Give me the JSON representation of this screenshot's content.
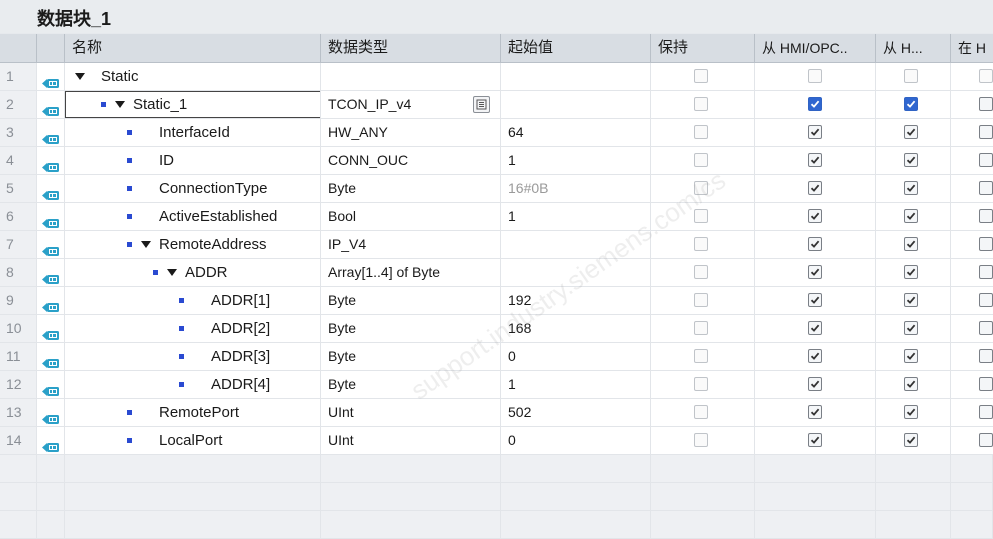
{
  "window": {
    "title": "数据块_1"
  },
  "columns": {
    "name": "名称",
    "data_type": "数据类型",
    "start_value": "起始值",
    "retain": "保持",
    "hmi_opc": "从 HMI/OPC..",
    "hmi_h": "从 H...",
    "in_h": "在 H"
  },
  "rows": [
    {
      "num": "1",
      "name": "Static",
      "type": "",
      "start": "",
      "level": 0,
      "expander": true,
      "bullet": false,
      "retain": false,
      "hmi1": false,
      "hmi2": false,
      "hmi_disabled": true
    },
    {
      "num": "2",
      "name": "Static_1",
      "type": "TCON_IP_v4",
      "start": "",
      "level": 1,
      "expander": true,
      "bullet": true,
      "retain": false,
      "hmi1": true,
      "hmi2": true,
      "selected": true
    },
    {
      "num": "3",
      "name": "InterfaceId",
      "type": "HW_ANY",
      "start": "64",
      "level": 2,
      "expander": false,
      "bullet": true,
      "retain": false,
      "hmi1": true,
      "hmi2": true
    },
    {
      "num": "4",
      "name": "ID",
      "type": "CONN_OUC",
      "start": "1",
      "level": 2,
      "expander": false,
      "bullet": true,
      "retain": false,
      "hmi1": true,
      "hmi2": true
    },
    {
      "num": "5",
      "name": "ConnectionType",
      "type": "Byte",
      "start": "16#0B",
      "level": 2,
      "expander": false,
      "bullet": true,
      "retain": false,
      "hmi1": true,
      "hmi2": true,
      "start_grey": true
    },
    {
      "num": "6",
      "name": "ActiveEstablished",
      "type": "Bool",
      "start": "1",
      "level": 2,
      "expander": false,
      "bullet": true,
      "retain": false,
      "hmi1": true,
      "hmi2": true
    },
    {
      "num": "7",
      "name": "RemoteAddress",
      "type": "IP_V4",
      "start": "",
      "level": 2,
      "expander": true,
      "bullet": true,
      "retain": false,
      "hmi1": true,
      "hmi2": true
    },
    {
      "num": "8",
      "name": "ADDR",
      "type": "Array[1..4] of Byte",
      "start": "",
      "level": 3,
      "expander": true,
      "bullet": true,
      "retain": false,
      "hmi1": true,
      "hmi2": true
    },
    {
      "num": "9",
      "name": "ADDR[1]",
      "type": "Byte",
      "start": "192",
      "level": 4,
      "expander": false,
      "bullet": true,
      "retain": false,
      "hmi1": true,
      "hmi2": true
    },
    {
      "num": "10",
      "name": "ADDR[2]",
      "type": "Byte",
      "start": "168",
      "level": 4,
      "expander": false,
      "bullet": true,
      "retain": false,
      "hmi1": true,
      "hmi2": true
    },
    {
      "num": "11",
      "name": "ADDR[3]",
      "type": "Byte",
      "start": "0",
      "level": 4,
      "expander": false,
      "bullet": true,
      "retain": false,
      "hmi1": true,
      "hmi2": true
    },
    {
      "num": "12",
      "name": "ADDR[4]",
      "type": "Byte",
      "start": "1",
      "level": 4,
      "expander": false,
      "bullet": true,
      "retain": false,
      "hmi1": true,
      "hmi2": true
    },
    {
      "num": "13",
      "name": "RemotePort",
      "type": "UInt",
      "start": "502",
      "level": 2,
      "expander": false,
      "bullet": true,
      "retain": false,
      "hmi1": true,
      "hmi2": true
    },
    {
      "num": "14",
      "name": "LocalPort",
      "type": "UInt",
      "start": "0",
      "level": 2,
      "expander": false,
      "bullet": true,
      "retain": false,
      "hmi1": true,
      "hmi2": true
    }
  ],
  "empty_rows": 3,
  "watermark": "support.industry.siemens.com/cs",
  "colors": {
    "accent": "#2f66d0",
    "bullet": "#2a4ad1",
    "header_bg": "#d8dde3"
  }
}
